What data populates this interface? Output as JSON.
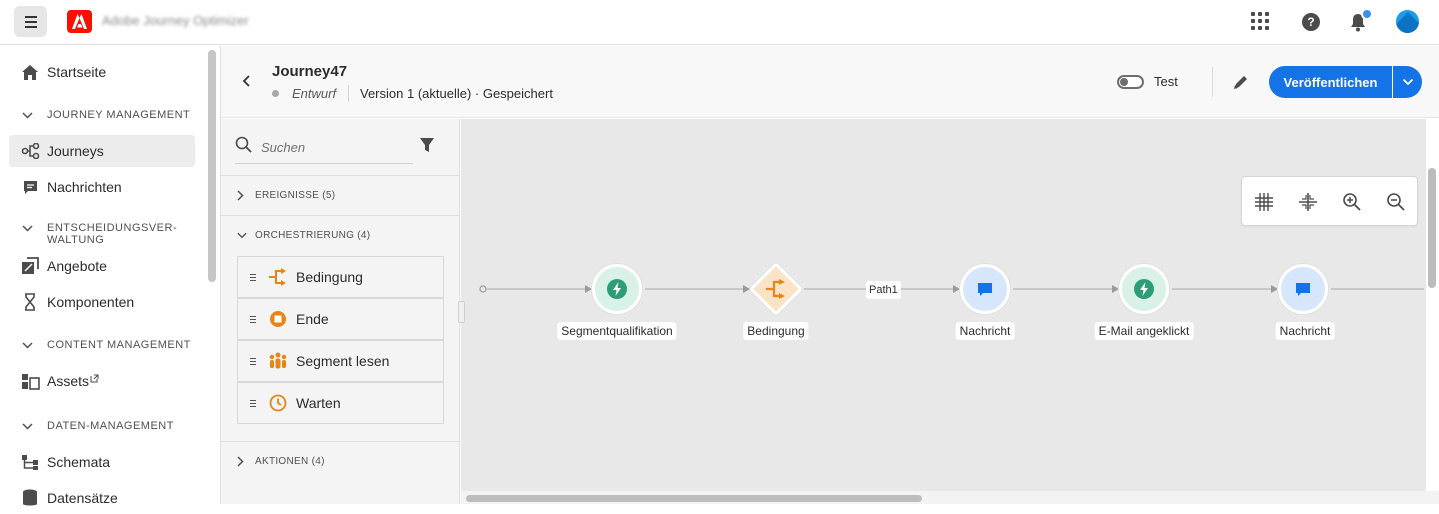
{
  "app": {
    "title": "Adobe Journey Optimizer"
  },
  "nav": {
    "home": "Startseite",
    "section_journey": "JOURNEY MANAGEMENT",
    "journeys": "Journeys",
    "messages": "Nachrichten",
    "section_decision_1": "ENTSCHEIDUNGSVER-",
    "section_decision_2": "WALTUNG",
    "offers": "Angebote",
    "components": "Komponenten",
    "section_content": "CONTENT MANAGEMENT",
    "assets": "Assets",
    "section_data": "DATEN-MANAGEMENT",
    "schemas": "Schemata",
    "datasets": "Datensätze"
  },
  "journey": {
    "name": "Journey47",
    "status": "Entwurf",
    "version": "Version 1 (aktuelle) · Gespeichert",
    "test_label": "Test",
    "publish_label": "Veröffentlichen"
  },
  "palette": {
    "search_placeholder": "Suchen",
    "events_header": "EREIGNISSE (5)",
    "orchestration_header": "ORCHESTRIERUNG (4)",
    "items": [
      {
        "label": "Bedingung",
        "icon": "condition-icon"
      },
      {
        "label": "Ende",
        "icon": "end-icon"
      },
      {
        "label": "Segment lesen",
        "icon": "read-segment-icon"
      },
      {
        "label": "Warten",
        "icon": "wait-icon"
      }
    ],
    "actions_header": "AKTIONEN (4)"
  },
  "canvas": {
    "nodes": [
      {
        "label": "Segmentqualifikation",
        "type": "event",
        "icon": "lightning-icon"
      },
      {
        "label": "Bedingung",
        "type": "condition",
        "icon": "condition-icon"
      },
      {
        "label": "Nachricht",
        "type": "message",
        "icon": "message-icon"
      },
      {
        "label": "E-Mail angeklickt",
        "type": "event",
        "icon": "lightning-icon"
      },
      {
        "label": "Nachricht",
        "type": "message",
        "icon": "message-icon"
      }
    ],
    "path_label": "Path1"
  },
  "colors": {
    "accent": "#1473e6",
    "brand_red": "#fa0f00",
    "event_green": "#2d9d78",
    "condition_orange": "#e68619",
    "message_blue": "#1473e6",
    "notification_dot": "#3b8fef"
  }
}
